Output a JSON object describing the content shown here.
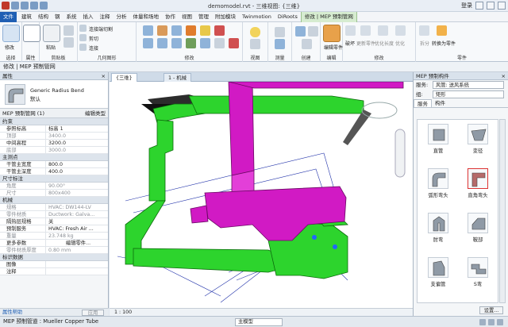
{
  "titlebar": {
    "title": "demomodel.rvt - 三维视图: {三维}",
    "login": "登录"
  },
  "menu": [
    "文件",
    "建筑",
    "结构",
    "钢",
    "系统",
    "插入",
    "注释",
    "分析",
    "体量和场地",
    "协作",
    "视图",
    "管理",
    "附加模块",
    "Twinmotion",
    "DiRoots",
    "修改 | MEP 预制管网"
  ],
  "ribbon": {
    "groups": [
      "选择",
      "属性",
      "剪贴板",
      "几何图形",
      "修改",
      "视图",
      "测量",
      "创建",
      "编辑",
      "修改",
      "零件"
    ],
    "modify_label": "修改",
    "paste_label": "粘贴",
    "geom": [
      "连接端切割",
      "剪切",
      "连接"
    ],
    "edit_parts": "编辑零件",
    "flip": "破坏",
    "tools": [
      "更新零件",
      "优化长度",
      "优化",
      "拆分",
      "转换为零件"
    ]
  },
  "optionsbar": "修改 | MEP 预制管网",
  "properties": {
    "header": "属性",
    "type_name": "Generic Radius Bend",
    "type_sub": "默认",
    "instance": "MEP 预制管网 (1)",
    "edit_type": "编辑类型",
    "groups": [
      {
        "title": "约束",
        "rows": [
          [
            "参照标高",
            "标高 1",
            false
          ],
          [
            "顶部",
            "3400.0",
            true
          ],
          [
            "中间高程",
            "3200.0",
            false
          ],
          [
            "底部",
            "3000.0",
            true
          ]
        ]
      },
      {
        "title": "主测点",
        "rows": [
          [
            "干管主宽度",
            "800.0",
            false
          ],
          [
            "干管主深度",
            "400.0",
            false
          ]
        ]
      },
      {
        "title": "尺寸标注",
        "rows": [
          [
            "角度",
            "90.00°",
            true
          ],
          [
            "尺寸",
            "800x400",
            true
          ]
        ]
      },
      {
        "title": "机械",
        "rows": [
          [
            "规格",
            "HVAC: DW144-LV",
            true
          ],
          [
            "零件材质",
            "Ductwork: Galva...",
            true
          ],
          [
            "隔热层规格",
            "关",
            false
          ],
          [
            "预制服务",
            "HVAC: Fresh Air ...",
            false
          ],
          [
            "重量",
            "23.748 kg",
            true
          ],
          [
            "零件材质厚度",
            "0.80 mm",
            true
          ]
        ]
      },
      {
        "title": "标识数据",
        "rows": [
          [
            "图像",
            ""
          ],
          [
            "注释",
            ""
          ]
        ]
      }
    ],
    "more_params": "更多参数",
    "edit_part_btn": "编辑零件...",
    "help": "属性帮助",
    "apply": "应用"
  },
  "view": {
    "tabs": [
      "{三维}",
      "1 - 机械"
    ],
    "scale": "1 : 100"
  },
  "library": {
    "header": "MEP 预制构件",
    "service_label": "服务:",
    "service_value": "风管: 送风系统",
    "group_label": "组:",
    "group_value": "矩形",
    "tabs": [
      "服务",
      "构件"
    ],
    "items": [
      "直管",
      "变径",
      "弧形弯头",
      "直角弯头",
      "肘弯",
      "鞍部",
      "支偏管",
      "S弯"
    ],
    "settings": "设置..."
  },
  "status": {
    "text": "MEP 预制管道 : Mueller Copper Tube",
    "model": "主模型"
  }
}
